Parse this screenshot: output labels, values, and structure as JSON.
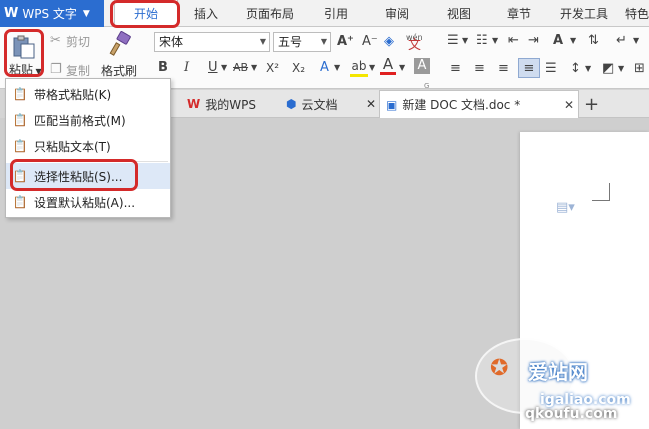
{
  "app": {
    "name": "WPS 文字",
    "logo": "W"
  },
  "menu_tabs": [
    "开始",
    "插入",
    "页面布局",
    "引用",
    "审阅",
    "视图",
    "章节",
    "开发工具",
    "特色"
  ],
  "ribbon": {
    "paste_label": "粘贴",
    "cut_label": "剪切",
    "copy_label": "复制",
    "format_painter_label": "格式刷",
    "font_name": "宋体",
    "font_size": "五号",
    "bold": "B",
    "italic": "I",
    "underline": "U",
    "strike": "AB",
    "superscript": "X²",
    "subscript": "X₂",
    "grow_font": "A⁺",
    "shrink_font": "A⁻",
    "phonetic": "wén",
    "font_color": "A",
    "char_shade": "A",
    "highlight": "ab",
    "group_mark": "G"
  },
  "paste_menu": {
    "items": [
      "带格式粘贴(K)",
      "匹配当前格式(M)",
      "只粘贴文本(T)",
      "选择性粘贴(S)...",
      "设置默认粘贴(A)..."
    ]
  },
  "doc_tabs": [
    {
      "label": "我的WPS",
      "icon": "wps-logo-icon"
    },
    {
      "label": "云文档",
      "icon": "cloud-cube-icon"
    },
    {
      "label": "新建 DOC 文档.doc *",
      "icon": "doc-icon"
    }
  ],
  "new_tab": "+",
  "watermark": {
    "line1": "爱站网",
    "line2": "igaliao.com",
    "line3": "qkoufu.com"
  },
  "colors": {
    "accent": "#2b6dd0",
    "highlight_box": "#d42a2a",
    "font_color_red": "#e02020",
    "highlight_yellow": "#f4e600"
  }
}
